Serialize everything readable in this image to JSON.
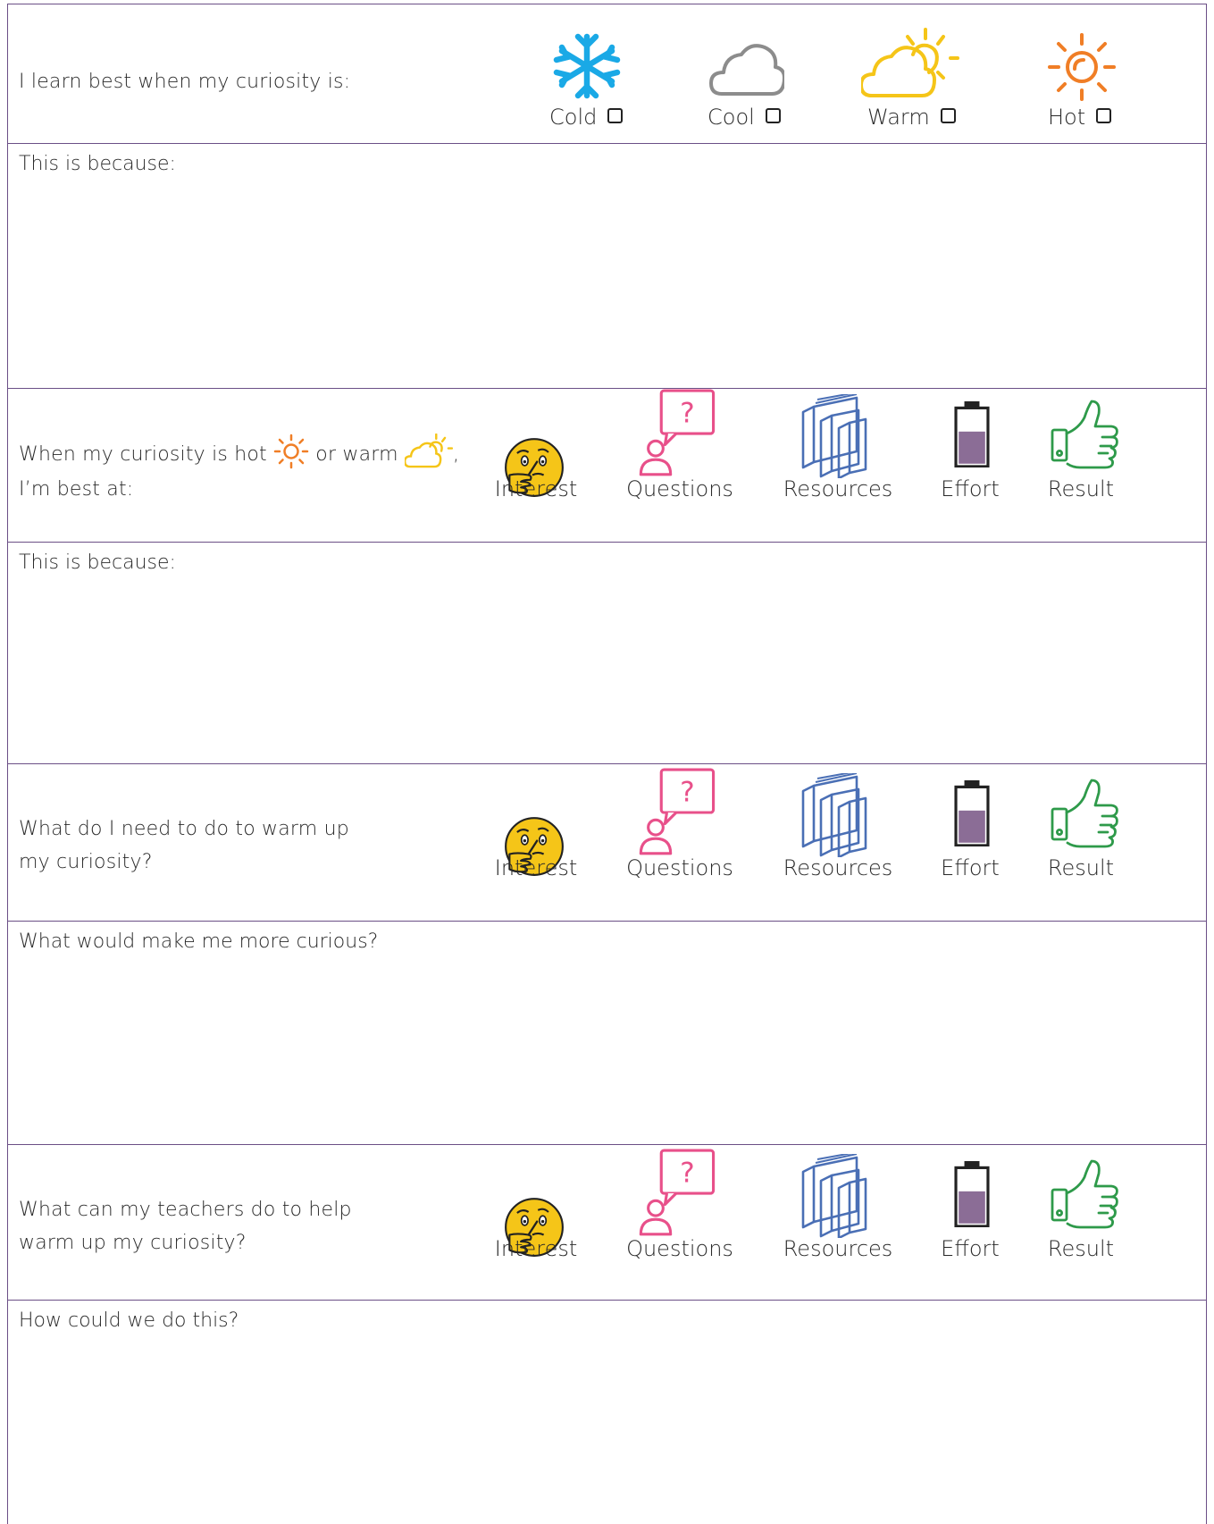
{
  "section1": {
    "prompt": "I learn best when my curiosity is:",
    "options": [
      {
        "label": "Cold",
        "icon": "snowflake-icon",
        "color": "#1aa9e6"
      },
      {
        "label": "Cool",
        "icon": "cloud-icon",
        "color": "#8c8c8c"
      },
      {
        "label": "Warm",
        "icon": "sun-cloud-icon",
        "color": "#f5c518"
      },
      {
        "label": "Hot",
        "icon": "sun-icon",
        "color": "#f07e26"
      }
    ],
    "answer_label": "This is because:"
  },
  "section2": {
    "prompt_part1": "When my curiosity is hot",
    "prompt_part2": "or warm",
    "prompt_part3": ",",
    "prompt_line2": "I’m best at:",
    "answer_label": "This is because:"
  },
  "section3": {
    "prompt_line1": "What do I need to do to warm up",
    "prompt_line2": "my curiosity?",
    "answer_label": "What would make me more curious?"
  },
  "section4": {
    "prompt_line1": "What can my teachers do to help",
    "prompt_line2": "warm up my curiosity?",
    "answer_label": "How could we do this?"
  },
  "categories": [
    {
      "label": "Interest",
      "icon": "thinking-face-icon",
      "color": "#f5c518"
    },
    {
      "label": "Questions",
      "icon": "person-question-icon",
      "color": "#e8508a"
    },
    {
      "label": "Resources",
      "icon": "books-icon",
      "color": "#4a6fb5"
    },
    {
      "label": "Effort",
      "icon": "battery-icon",
      "color": "#6b4f86"
    },
    {
      "label": "Result",
      "icon": "thumbs-up-icon",
      "color": "#2e9a4a"
    }
  ],
  "colors": {
    "border": "#6b4f86"
  }
}
